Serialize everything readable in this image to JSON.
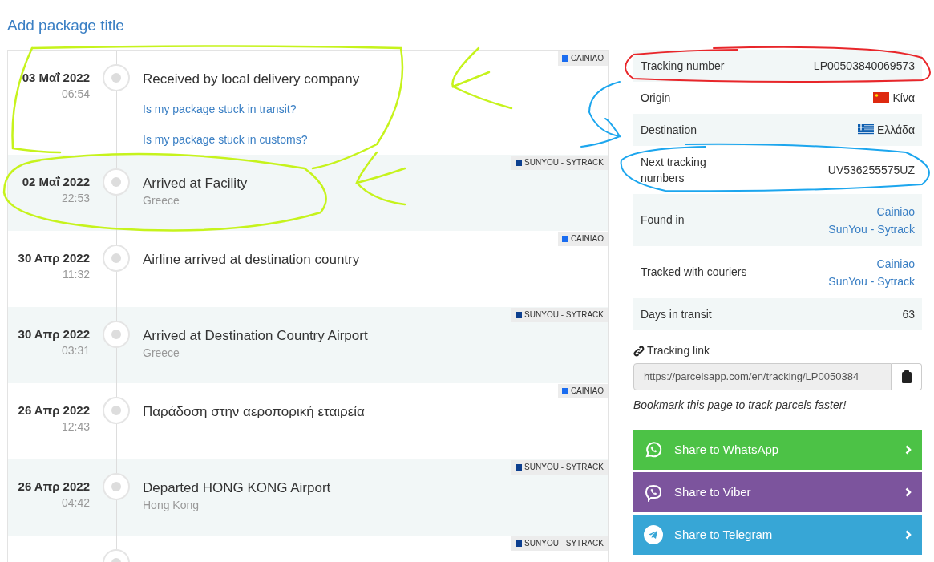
{
  "title_link": "Add package title",
  "events": [
    {
      "date": "03 Μαΐ 2022",
      "time": "06:54",
      "title": "Received by local delivery company",
      "courier": "CAINIAO",
      "color": "#1a6cf0",
      "links": [
        "Is my package stuck in transit?",
        "Is my package stuck in customs?"
      ]
    },
    {
      "date": "02 Μαΐ 2022",
      "time": "22:53",
      "title": "Arrived at Facility",
      "location": "Greece",
      "courier": "SUNYOU - SYTRACK",
      "color": "#0d3f8f"
    },
    {
      "date": "30 Απρ 2022",
      "time": "11:32",
      "title": "Airline arrived at destination country",
      "courier": "CAINIAO",
      "color": "#1a6cf0"
    },
    {
      "date": "30 Απρ 2022",
      "time": "03:31",
      "title": "Arrived at Destination Country Airport",
      "location": "Greece",
      "courier": "SUNYOU - SYTRACK",
      "color": "#0d3f8f"
    },
    {
      "date": "26 Απρ 2022",
      "time": "12:43",
      "title": "Παράδοση στην αεροπορική εταιρεία",
      "courier": "CAINIAO",
      "color": "#1a6cf0"
    },
    {
      "date": "26 Απρ 2022",
      "time": "04:42",
      "title": "Departed HONG KONG Airport",
      "location": "Hong Kong",
      "courier": "SUNYOU - SYTRACK",
      "color": "#0d3f8f"
    },
    {
      "courier": "SUNYOU - SYTRACK",
      "color": "#0d3f8f"
    }
  ],
  "details": [
    {
      "kind": "text",
      "label": "Tracking number",
      "value": "LP00503840069573"
    },
    {
      "kind": "flag",
      "label": "Origin",
      "value": "Κίνα",
      "flag": {
        "kind": "china"
      }
    },
    {
      "kind": "flag",
      "label": "Destination",
      "value": "Ελλάδα",
      "flag": {
        "kind": "greece"
      }
    },
    {
      "kind": "text",
      "label": "Next tracking numbers",
      "value": "UV536255575UZ"
    },
    {
      "kind": "links",
      "label": "Found in",
      "links": [
        "Cainiao",
        "SunYou - Sytrack"
      ]
    },
    {
      "kind": "links",
      "label": "Tracked with couriers",
      "links": [
        "Cainiao",
        "SunYou - Sytrack"
      ]
    },
    {
      "kind": "text",
      "label": "Days in transit",
      "value": "63"
    }
  ],
  "tracking_link": {
    "label": "Tracking link",
    "value": "https://parcelsapp.com/en/tracking/LP0050384"
  },
  "bookmark_note": "Bookmark this page to track parcels faster!",
  "share_buttons": [
    {
      "kind": "whatsapp",
      "label": "Share to WhatsApp",
      "color": "#4cc246"
    },
    {
      "kind": "viber",
      "label": "Share to Viber",
      "color": "#7c549d"
    },
    {
      "kind": "telegram",
      "label": "Share to Telegram",
      "color": "#37a6d6"
    }
  ]
}
